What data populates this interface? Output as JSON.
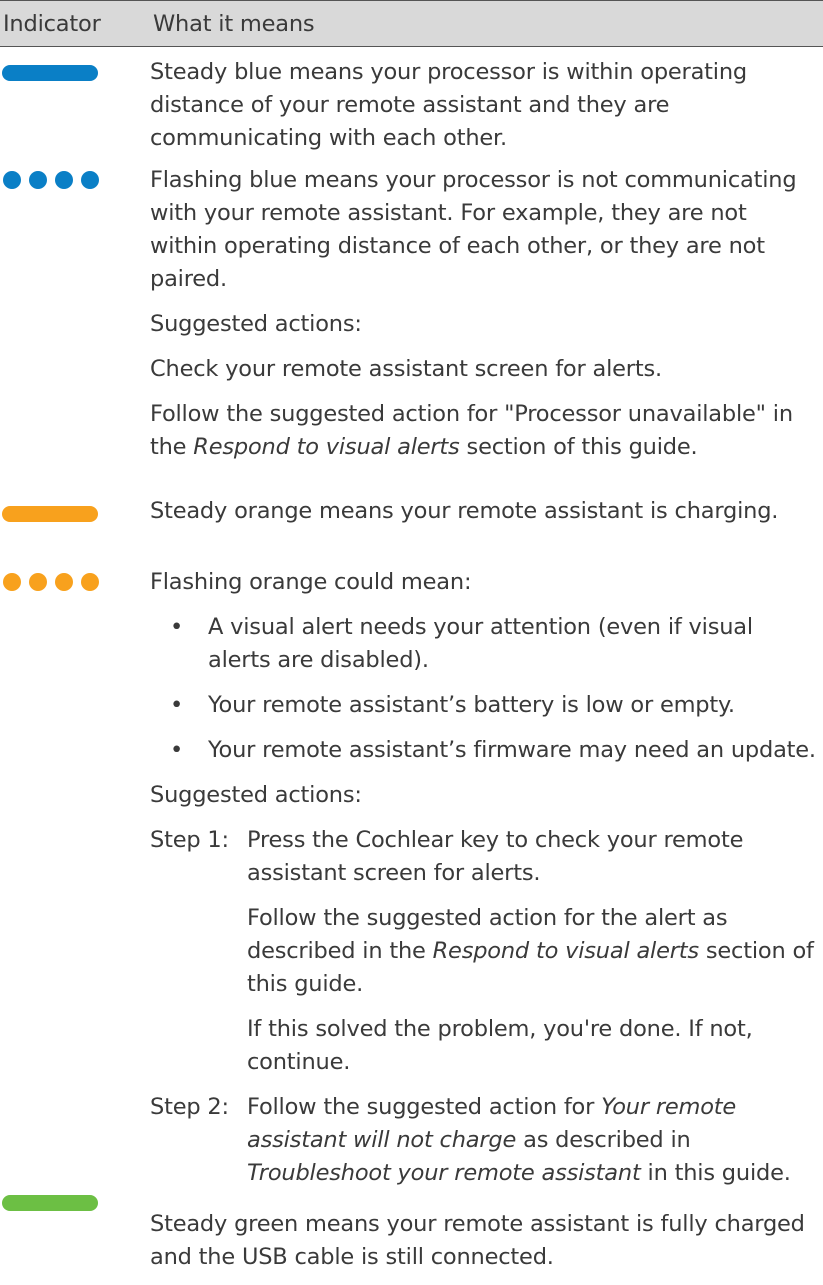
{
  "header": {
    "col_indicator": "Indicator",
    "col_meaning": "What it means"
  },
  "colors": {
    "blue": "#0a7fc6",
    "orange": "#f8a11d",
    "green": "#6cbf44",
    "header_bg": "#d9d9d9"
  },
  "rows": {
    "steady_blue": {
      "indicator": "steady-blue-bar",
      "text": "Steady blue means your processor is within operating distance of your remote assistant and they are communicating with each other."
    },
    "flashing_blue": {
      "indicator": "flashing-blue-dots",
      "text": "Flashing blue means your processor is not communicating with your remote assistant. For example, they are not within operating distance of each other, or they are not paired.",
      "suggested": "Suggested actions:",
      "action1": "Check your remote assistant screen for alerts.",
      "action2_pre": "Follow the suggested action for \"Processor unavailable\" in the ",
      "action2_em": "Respond to visual alerts",
      "action2_post": " section of this guide."
    },
    "steady_orange": {
      "indicator": "steady-orange-bar",
      "text": "Steady orange means your remote assistant is charging."
    },
    "flashing_orange": {
      "indicator": "flashing-orange-dots",
      "intro": "Flashing orange could mean:",
      "bullets": [
        "A visual alert needs your attention (even if visual alerts are disabled).",
        "Your remote assistant’s battery is low or empty.",
        "Your remote assistant’s firmware may need an update."
      ],
      "bullet_char": "•",
      "suggested": "Suggested actions:",
      "step1_label": "Step 1:",
      "step1_text": "Press the Cochlear key to check your remote assistant screen for alerts.",
      "step1_p2_pre": "Follow the suggested action for the alert as described in the ",
      "step1_p2_em": "Respond to visual alerts",
      "step1_p2_post": " section of this guide.",
      "step1_p3": "If this solved the problem, you're done. If not, continue.",
      "step2_label": "Step 2:",
      "step2_pre": "Follow the suggested action for ",
      "step2_em1": "Your remote assistant will not charge",
      "step2_mid": " as described in ",
      "step2_em2": "Troubleshoot your remote assistant",
      "step2_post": " in this guide."
    },
    "steady_green": {
      "indicator": "steady-green-bar",
      "text": "Steady green means your remote assistant is fully charged and the USB cable is still connected."
    }
  }
}
